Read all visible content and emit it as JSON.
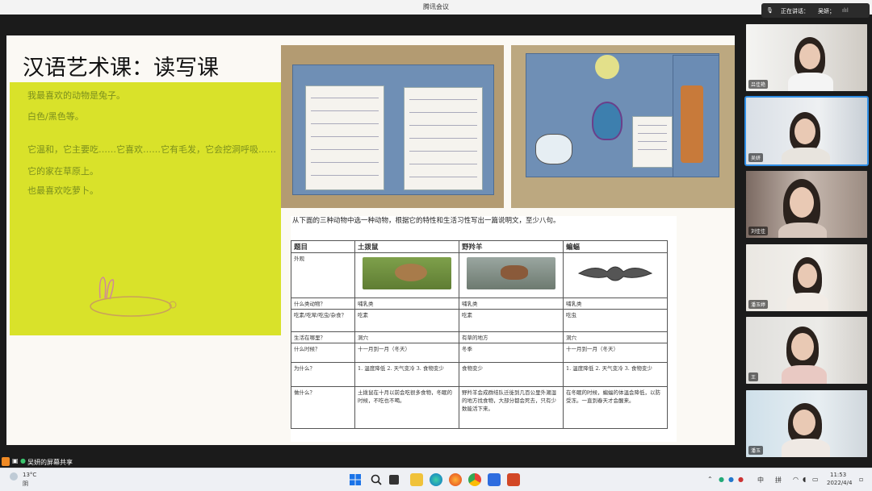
{
  "window": {
    "title": "腾讯会议"
  },
  "slide": {
    "title": "汉语艺术课：读写课",
    "handwriting": [
      "我最喜欢的动物是兔子。",
      "白色/黑色等。",
      "它温和，它主要吃……它喜欢……它有毛发，它会挖洞呼吸……",
      "它的家在草原上。",
      "也最喜欢吃萝卜。"
    ]
  },
  "worksheet": {
    "instruction": "从下面的三种动物中选一种动物，根据它的特性和生活习性写出一篇说明文，至少八句。",
    "headers": [
      "题目",
      "土拨鼠",
      "野羚羊",
      "蝙蝠"
    ],
    "rows": [
      {
        "label": "外观",
        "cells": [
          "",
          "",
          ""
        ]
      },
      {
        "label": "什么类动物？",
        "cells": [
          "哺乳类",
          "哺乳类",
          "哺乳类"
        ]
      },
      {
        "label": "吃素/吃荤/吃虫/杂食？",
        "cells": [
          "吃素",
          "吃素",
          "吃虫"
        ]
      },
      {
        "label": "生活在哪里？",
        "cells": [
          "洞穴",
          "有草的地方",
          "洞穴"
        ]
      },
      {
        "label": "什么时候？",
        "cells": [
          "十一月到一月（冬天）",
          "冬季",
          "十一月到一月（冬天）"
        ]
      },
      {
        "label": "为什么？",
        "cells": [
          "1. 温度降低 2. 天气变冷 3. 食物变少",
          "食物变少",
          "1. 温度降低 2. 天气变冷 3. 食物变少"
        ]
      },
      {
        "label": "做什么？",
        "cells": [
          "土拨鼠在十月以前会吃很多食物，冬眠的时候，不吃也不喝。",
          "野羚羊会成群结队迁徙到几百公里外潮湿的地方找食物，大部分都会死去，只有少数能活下来。",
          "在冬眠的时候，蝙蝠的体温会降低，以防受冻。一直到春天才会醒来。"
        ]
      }
    ]
  },
  "meeting": {
    "speaking_label": "正在讲话：",
    "speaking_name": "吴妍；",
    "participants": [
      {
        "name": "吕佳艳"
      },
      {
        "name": "吴妍"
      },
      {
        "name": "刘佳佳"
      },
      {
        "name": "潘玉婷"
      },
      {
        "name": "王"
      },
      {
        "name": "潘玉"
      }
    ],
    "share_label": "吴妍的屏幕共享"
  },
  "taskbar": {
    "weather_temp": "13°C",
    "weather_desc": "阴",
    "ime_lang": "中",
    "ime_mode": "拼",
    "time": "11:53",
    "date": "2022/4/4"
  },
  "colors": {
    "highlight_yellow": "#d9e22a",
    "active_border": "#2f8de4"
  }
}
